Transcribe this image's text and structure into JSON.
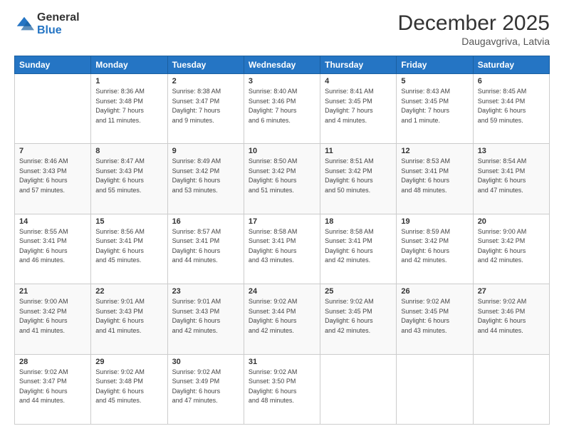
{
  "header": {
    "logo_general": "General",
    "logo_blue": "Blue",
    "title": "December 2025",
    "subtitle": "Daugavgriva, Latvia"
  },
  "calendar": {
    "weekdays": [
      "Sunday",
      "Monday",
      "Tuesday",
      "Wednesday",
      "Thursday",
      "Friday",
      "Saturday"
    ],
    "weeks": [
      [
        {
          "day": "",
          "info": ""
        },
        {
          "day": "1",
          "info": "Sunrise: 8:36 AM\nSunset: 3:48 PM\nDaylight: 7 hours\nand 11 minutes."
        },
        {
          "day": "2",
          "info": "Sunrise: 8:38 AM\nSunset: 3:47 PM\nDaylight: 7 hours\nand 9 minutes."
        },
        {
          "day": "3",
          "info": "Sunrise: 8:40 AM\nSunset: 3:46 PM\nDaylight: 7 hours\nand 6 minutes."
        },
        {
          "day": "4",
          "info": "Sunrise: 8:41 AM\nSunset: 3:45 PM\nDaylight: 7 hours\nand 4 minutes."
        },
        {
          "day": "5",
          "info": "Sunrise: 8:43 AM\nSunset: 3:45 PM\nDaylight: 7 hours\nand 1 minute."
        },
        {
          "day": "6",
          "info": "Sunrise: 8:45 AM\nSunset: 3:44 PM\nDaylight: 6 hours\nand 59 minutes."
        }
      ],
      [
        {
          "day": "7",
          "info": "Sunrise: 8:46 AM\nSunset: 3:43 PM\nDaylight: 6 hours\nand 57 minutes."
        },
        {
          "day": "8",
          "info": "Sunrise: 8:47 AM\nSunset: 3:43 PM\nDaylight: 6 hours\nand 55 minutes."
        },
        {
          "day": "9",
          "info": "Sunrise: 8:49 AM\nSunset: 3:42 PM\nDaylight: 6 hours\nand 53 minutes."
        },
        {
          "day": "10",
          "info": "Sunrise: 8:50 AM\nSunset: 3:42 PM\nDaylight: 6 hours\nand 51 minutes."
        },
        {
          "day": "11",
          "info": "Sunrise: 8:51 AM\nSunset: 3:42 PM\nDaylight: 6 hours\nand 50 minutes."
        },
        {
          "day": "12",
          "info": "Sunrise: 8:53 AM\nSunset: 3:41 PM\nDaylight: 6 hours\nand 48 minutes."
        },
        {
          "day": "13",
          "info": "Sunrise: 8:54 AM\nSunset: 3:41 PM\nDaylight: 6 hours\nand 47 minutes."
        }
      ],
      [
        {
          "day": "14",
          "info": "Sunrise: 8:55 AM\nSunset: 3:41 PM\nDaylight: 6 hours\nand 46 minutes."
        },
        {
          "day": "15",
          "info": "Sunrise: 8:56 AM\nSunset: 3:41 PM\nDaylight: 6 hours\nand 45 minutes."
        },
        {
          "day": "16",
          "info": "Sunrise: 8:57 AM\nSunset: 3:41 PM\nDaylight: 6 hours\nand 44 minutes."
        },
        {
          "day": "17",
          "info": "Sunrise: 8:58 AM\nSunset: 3:41 PM\nDaylight: 6 hours\nand 43 minutes."
        },
        {
          "day": "18",
          "info": "Sunrise: 8:58 AM\nSunset: 3:41 PM\nDaylight: 6 hours\nand 42 minutes."
        },
        {
          "day": "19",
          "info": "Sunrise: 8:59 AM\nSunset: 3:42 PM\nDaylight: 6 hours\nand 42 minutes."
        },
        {
          "day": "20",
          "info": "Sunrise: 9:00 AM\nSunset: 3:42 PM\nDaylight: 6 hours\nand 42 minutes."
        }
      ],
      [
        {
          "day": "21",
          "info": "Sunrise: 9:00 AM\nSunset: 3:42 PM\nDaylight: 6 hours\nand 41 minutes."
        },
        {
          "day": "22",
          "info": "Sunrise: 9:01 AM\nSunset: 3:43 PM\nDaylight: 6 hours\nand 41 minutes."
        },
        {
          "day": "23",
          "info": "Sunrise: 9:01 AM\nSunset: 3:43 PM\nDaylight: 6 hours\nand 42 minutes."
        },
        {
          "day": "24",
          "info": "Sunrise: 9:02 AM\nSunset: 3:44 PM\nDaylight: 6 hours\nand 42 minutes."
        },
        {
          "day": "25",
          "info": "Sunrise: 9:02 AM\nSunset: 3:45 PM\nDaylight: 6 hours\nand 42 minutes."
        },
        {
          "day": "26",
          "info": "Sunrise: 9:02 AM\nSunset: 3:45 PM\nDaylight: 6 hours\nand 43 minutes."
        },
        {
          "day": "27",
          "info": "Sunrise: 9:02 AM\nSunset: 3:46 PM\nDaylight: 6 hours\nand 44 minutes."
        }
      ],
      [
        {
          "day": "28",
          "info": "Sunrise: 9:02 AM\nSunset: 3:47 PM\nDaylight: 6 hours\nand 44 minutes."
        },
        {
          "day": "29",
          "info": "Sunrise: 9:02 AM\nSunset: 3:48 PM\nDaylight: 6 hours\nand 45 minutes."
        },
        {
          "day": "30",
          "info": "Sunrise: 9:02 AM\nSunset: 3:49 PM\nDaylight: 6 hours\nand 47 minutes."
        },
        {
          "day": "31",
          "info": "Sunrise: 9:02 AM\nSunset: 3:50 PM\nDaylight: 6 hours\nand 48 minutes."
        },
        {
          "day": "",
          "info": ""
        },
        {
          "day": "",
          "info": ""
        },
        {
          "day": "",
          "info": ""
        }
      ]
    ]
  }
}
